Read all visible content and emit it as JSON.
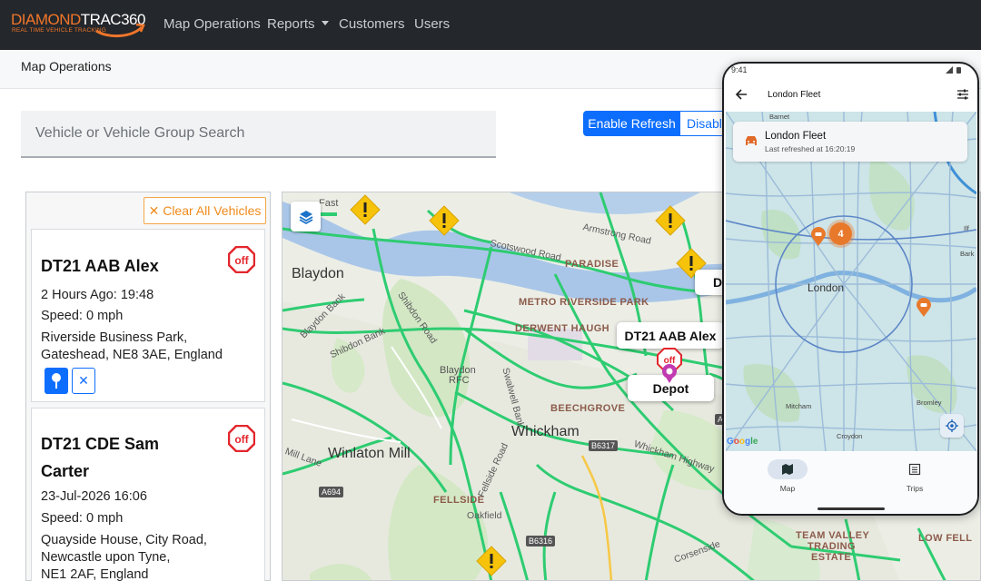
{
  "navbar": {
    "logo": {
      "brand_prefix": "DIAMOND",
      "brand_suffix": "TRAC",
      "brand_number": "360",
      "tagline": "REAL TIME VEHICLE TRACKING"
    },
    "items": [
      {
        "label": "Map Operations"
      },
      {
        "label": "Reports"
      },
      {
        "label": "Customers"
      },
      {
        "label": "Users"
      }
    ]
  },
  "page": {
    "title": "Map Operations"
  },
  "search": {
    "placeholder": "Vehicle or Vehicle Group Search"
  },
  "refresh": {
    "enable_label": "Enable Refresh",
    "disable_label": "Disable"
  },
  "panel": {
    "clear_label": "✕ Clear All Vehicles"
  },
  "vehicles": [
    {
      "name": "DT21 AAB Alex",
      "last_seen": "2 Hours Ago: 19:48",
      "speed": "Speed: 0 mph",
      "address_line1": "Riverside Business Park,",
      "address_line2": "Gateshead, NE8 3AE, England",
      "status_badge": "off",
      "remove_label": "✕"
    },
    {
      "name_line1": "DT21 CDE Sam",
      "name_line2": "Carter",
      "last_seen": "23-Jul-2026 16:06",
      "speed": "Speed: 0 mph",
      "address_line1": "Quayside House, City Road,",
      "address_line2": "Newcastle upon Tyne,",
      "address_line3": "NE1 2AF, England",
      "status_badge": "off"
    }
  ],
  "map": {
    "labels": {
      "blaydon": "Blaydon",
      "whickham": "Whickham",
      "winlaton_mill": "Winlaton Mill",
      "metro_riverside_park": "METRO RIVERSIDE PARK",
      "derwent_haugh": "DERWENT HAUGH",
      "paradise": "PARADISE",
      "beechgrove": "BEECHGROVE",
      "fellside": "FELLSIDE",
      "team_valley_1": "TEAM VALLEY",
      "team_valley_2": "TRADING",
      "team_valley_3": "ESTATE",
      "low_fell": "LOW FELL",
      "blaydon_rfc_1": "Blaydon",
      "blaydon_rfc_2": "RFC",
      "scotswood_road": "Scotswood Road",
      "armstrong_road": "Armstrong Road",
      "shibdon_bank": "Shibdon Bank",
      "shibdon_road": "Shibdon Road",
      "blaydon_bank": "Blaydon Bank",
      "mill_lane": "Mill Lane",
      "whickham_highway": "Whickham Highway",
      "fellside_road": "Fellside Road",
      "oakfield": "Oakfield",
      "swalwell_bank": "Swalwell Bank",
      "corsenside": "Corsenside",
      "fast": "Fast",
      "b6317": "B6317",
      "b6316": "B6316",
      "a694": "A694",
      "a_road": "A"
    },
    "popups": {
      "vehicle": "DT21 AAB Alex",
      "depot": "Depot",
      "partial": "D"
    },
    "vehicle_marker_badge": "off"
  },
  "phone": {
    "status_time": "9:41",
    "title": "London Fleet",
    "card_title": "London Fleet",
    "card_subtitle": "Last refreshed at 16:20:19",
    "cluster_count": "4",
    "labels": {
      "barnet": "Barnet",
      "london": "London",
      "mitcham": "Mitcham",
      "croydon": "Croydon",
      "bromley": "Bromley",
      "bark": "Bark",
      "ilford": "Ilf"
    },
    "google": "Google",
    "nav": [
      {
        "label": "Map"
      },
      {
        "label": "Trips"
      }
    ]
  },
  "colors": {
    "navbar_bg": "#24272b",
    "accent_orange": "#f0762b",
    "primary_blue": "#0d6efd",
    "traffic_green": "#2ecc71",
    "warning_yellow": "#f6c30a",
    "stop_red": "#e3262d"
  }
}
